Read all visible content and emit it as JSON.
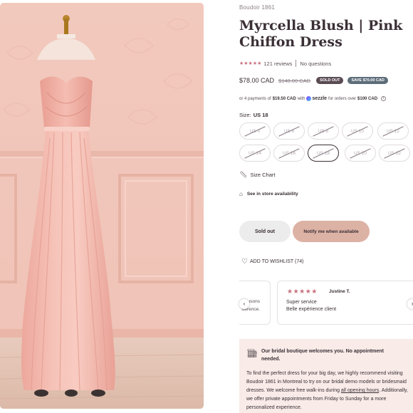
{
  "product": {
    "brand": "Boudoir 1861",
    "title": "Myrcella Blush | Pink Chiffon Dress",
    "stars": "★★★★★",
    "review_count": "121 reviews",
    "questions": "No questions",
    "price": "$78.00 CAD",
    "old_price": "$148.00 CAD",
    "sold_out_badge": "SOLD OUT",
    "save_badge": "SAVE $70.00 CAD",
    "image_alt": "Blush pink strapless chiffon dress on mannequin"
  },
  "sezzle": {
    "prefix": "or 4 payments of",
    "amount": "$19.50 CAD",
    "with": "with",
    "logo": "sezzle",
    "suffix": "for orders over",
    "threshold": "$100 CAD",
    "info": "i"
  },
  "size": {
    "label": "Size:",
    "selected": "US 18",
    "options": [
      "US 0",
      "US 6",
      "US 8",
      "US 10",
      "US 12",
      "US 14",
      "US 16",
      "US 18",
      "US 20",
      "US 22"
    ]
  },
  "links": {
    "size_chart": "Size Chart",
    "store": "See in store availability",
    "wishlist": "ADD TO WISHLIST (74)"
  },
  "buttons": {
    "sold_out": "Sold out",
    "notify": "Notify me when available"
  },
  "reviews_carousel": {
    "prev_partial_line1": "ısons",
    "prev_partial_line2": "ßérence.",
    "stars": "★★★★★",
    "reviewer": "Justine T.",
    "title": "Super service",
    "body": "Belle expérience client",
    "prev_arrow": "‹",
    "next_arrow": "›"
  },
  "boutique": {
    "title": "Our bridal boutique welcomes you. No appointment needed.",
    "text_before_link": "To find the perfect dress for your big day, we highly recommend visiting Boudoir 1861 in Montreal to try on our bridal demo models or bridesmaid dresses. We welcome free walk-ins during ",
    "link": "all opening hours",
    "text_after_link": ". Additionally, we offer private appointments from Friday to Sunday for a more personalized experience."
  },
  "colors": {
    "accent_pink": "#dcb2a5",
    "star_pink": "#c9707d",
    "panel_bg": "#f8ebe8",
    "wall_pink": "#f0c4b8",
    "dress_pink": "#f3b7ad"
  }
}
